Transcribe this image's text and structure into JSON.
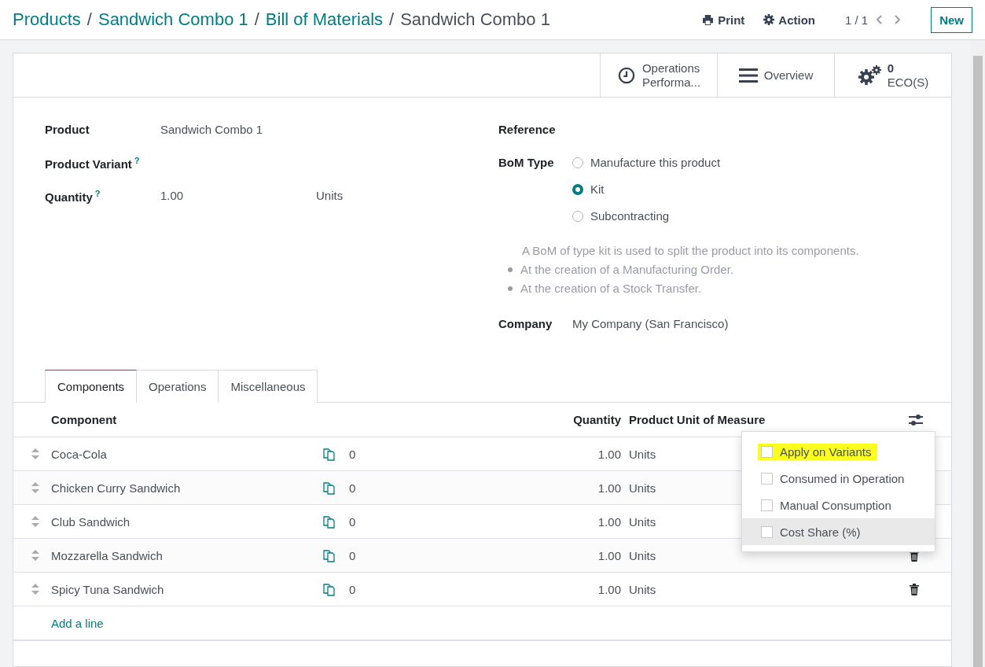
{
  "breadcrumbs": [
    {
      "label": "Products",
      "current": false
    },
    {
      "separator": "/",
      "label": "Sandwich Combo 1",
      "current": false
    },
    {
      "separator": "/",
      "label": "Bill of Materials",
      "current": false
    },
    {
      "separator": "/",
      "label": "Sandwich Combo 1",
      "current": true
    }
  ],
  "toolbar": {
    "print": "Print",
    "action": "Action",
    "pager": "1 / 1",
    "new_button": "New"
  },
  "stat_buttons": [
    {
      "kind": "clock",
      "lines": [
        "Operations",
        "Performa..."
      ]
    },
    {
      "kind": "list",
      "lines": [
        "Overview"
      ]
    },
    {
      "kind": "gears",
      "value": "0",
      "lines": [
        "ECO(S)"
      ]
    }
  ],
  "form": {
    "left": [
      {
        "label": "Product",
        "value": "Sandwich Combo 1"
      },
      {
        "label": "Product Variant",
        "help": "?"
      },
      {
        "label": "Quantity",
        "help": "?",
        "value": "1.00",
        "unit": "Units"
      }
    ],
    "reference": {
      "label": "Reference"
    },
    "bom_type": {
      "label": "BoM Type",
      "options": [
        {
          "label": "Manufacture this product",
          "selected": false
        },
        {
          "label": "Kit",
          "selected": true
        },
        {
          "label": "Subcontracting",
          "selected": false
        }
      ]
    },
    "help_text": {
      "intro": "A BoM of type kit is used to split the product into its components.",
      "bullets": [
        "At the creation of a Manufacturing Order.",
        "At the creation of a Stock Transfer."
      ]
    },
    "company": {
      "label": "Company",
      "value": "My Company (San Francisco)"
    }
  },
  "tabs": [
    {
      "label": "Components",
      "selected": true
    },
    {
      "label": "Operations",
      "selected": false
    },
    {
      "label": "Miscellaneous",
      "selected": false
    }
  ],
  "table": {
    "columns": [
      "Component",
      "Quantity",
      "Product Unit of Measure"
    ],
    "rows": [
      {
        "component": "Coca-Cola",
        "count": "0",
        "quantity": "1.00",
        "uom": "Units",
        "delete_visible": false
      },
      {
        "component": "Chicken Curry Sandwich",
        "count": "0",
        "quantity": "1.00",
        "uom": "Units",
        "delete_visible": false
      },
      {
        "component": "Club Sandwich",
        "count": "0",
        "quantity": "1.00",
        "uom": "Units",
        "delete_visible": false
      },
      {
        "component": "Mozzarella Sandwich",
        "count": "0",
        "quantity": "1.00",
        "uom": "Units",
        "delete_visible": true
      },
      {
        "component": "Spicy Tuna Sandwich",
        "count": "0",
        "quantity": "1.00",
        "uom": "Units",
        "delete_visible": true
      }
    ],
    "add_line": "Add a line"
  },
  "column_menu": {
    "items": [
      {
        "label": "Apply on Variants",
        "checked": false,
        "marked": true,
        "hovered": false
      },
      {
        "label": "Consumed in Operation",
        "checked": false,
        "marked": false,
        "hovered": false
      },
      {
        "label": "Manual Consumption",
        "checked": false,
        "marked": false,
        "hovered": false
      },
      {
        "label": "Cost Share (%)",
        "checked": false,
        "marked": false,
        "hovered": true
      }
    ]
  }
}
